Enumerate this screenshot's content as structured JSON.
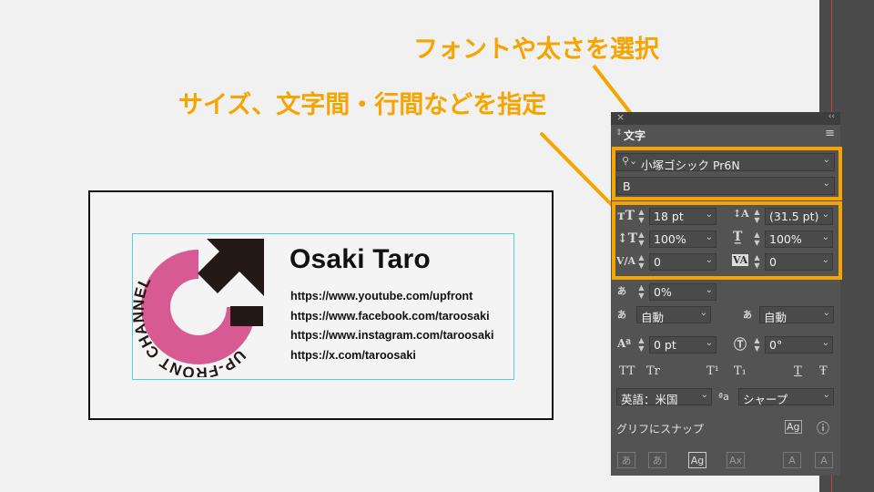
{
  "annotations": {
    "font_select": "フォントや太さを選択",
    "spacing": "サイズ、文字間・行間などを指定"
  },
  "card": {
    "name": "Osaki Taro",
    "links": [
      "https://www.youtube.com/upfront",
      "https://www.facebook.com/taroosaki",
      "https://www.instagram.com/taroosaki",
      "https://x.com/taroosaki"
    ],
    "logo_text": "UP-FRONT CHANNEL"
  },
  "panel": {
    "title": "文字",
    "font_family": "小塚ゴシック Pr6N",
    "font_style": "B",
    "font_size": "18 pt",
    "leading": "(31.5 pt)",
    "vertical_scale": "100%",
    "horizontal_scale": "100%",
    "kerning": "0",
    "tracking": "0",
    "tsume": "0%",
    "aki_left": "自動",
    "aki_right": "自動",
    "baseline_shift": "0 pt",
    "rotation": "0°",
    "style_buttons": [
      "TT",
      "Tr",
      "T¹",
      "T₁",
      "T",
      "Ŧ"
    ],
    "language": "英語：米国",
    "aa_label": "ªa",
    "antialias": "シャープ",
    "snap_label": "グリフにスナップ",
    "snap_icon_text": "Ag",
    "bottom_icons": [
      "あ",
      "あ",
      "Ag",
      "Ax",
      "A",
      "A"
    ]
  },
  "colors": {
    "highlight": "#f5a400",
    "logo_pink": "#d75a92",
    "logo_dark": "#231815",
    "panel_bg": "#535353"
  }
}
